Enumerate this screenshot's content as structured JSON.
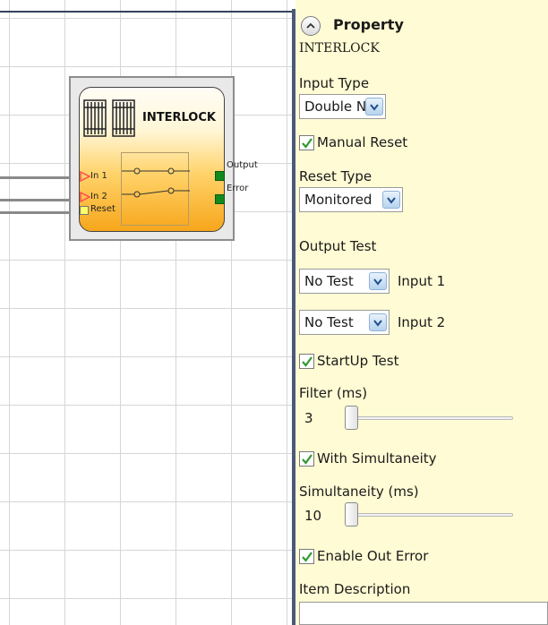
{
  "canvas": {
    "block": {
      "title": "INTERLOCK",
      "inputs": [
        "In 1",
        "In 2",
        "Reset"
      ],
      "outputs": [
        "Output",
        "Error"
      ],
      "colors": {
        "input_port": "#ff4d4d",
        "reset_port": "#ffff66",
        "output_port": "#118a1d"
      }
    }
  },
  "panel": {
    "header": "Property",
    "block_name": "INTERLOCK",
    "input_type": {
      "label": "Input Type",
      "value": "Double NC"
    },
    "manual_reset": {
      "label": "Manual Reset",
      "checked": true
    },
    "reset_type": {
      "label": "Reset Type",
      "value": "Monitored"
    },
    "output_test": {
      "label": "Output Test",
      "rows": [
        {
          "value": "No Test",
          "label": "Input 1"
        },
        {
          "value": "No Test",
          "label": "Input 2"
        }
      ]
    },
    "startup_test": {
      "label": "StartUp Test",
      "checked": true
    },
    "filter": {
      "label": "Filter (ms)",
      "value": "3"
    },
    "with_simultaneity": {
      "label": "With Simultaneity",
      "checked": true
    },
    "simultaneity": {
      "label": "Simultaneity (ms)",
      "value": "10"
    },
    "enable_out_error": {
      "label": "Enable Out Error",
      "checked": true
    },
    "item_description": {
      "label": "Item Description",
      "value": ""
    }
  },
  "colors": {
    "panel_bg": "#fffbd4",
    "check_green": "#2e9a2e",
    "accent_blue": "#3b78c4"
  },
  "icons": [
    "collapse-up-icon",
    "gate-icon",
    "chevron-down-icon",
    "checkmark-icon"
  ]
}
